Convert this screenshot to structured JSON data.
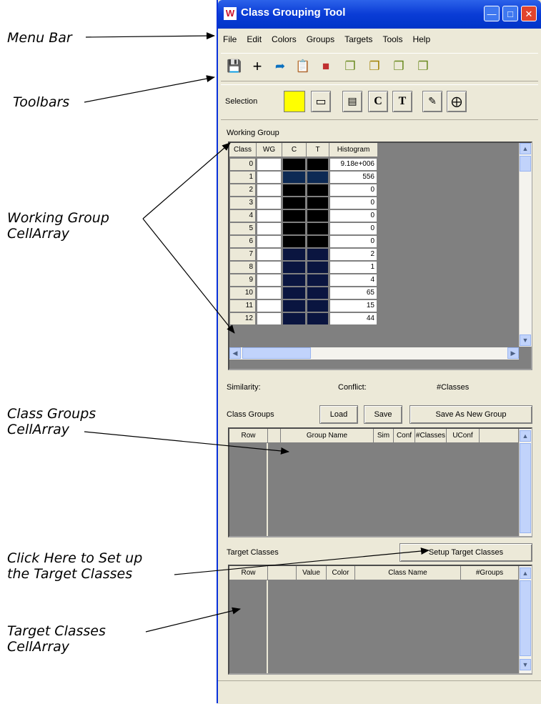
{
  "callouts": {
    "menu_bar": "Menu Bar",
    "toolbars": "Toolbars",
    "working_group": "Working Group\nCellArray",
    "class_groups": "Class Groups\nCellArray",
    "setup_hint": "Click Here to Set up\nthe Target Classes",
    "target_classes": "Target Classes\nCellArray"
  },
  "window": {
    "title": "Class Grouping Tool",
    "menu": [
      "File",
      "Edit",
      "Colors",
      "Groups",
      "Targets",
      "Tools",
      "Help"
    ],
    "toolbar_icons": [
      "save-icon",
      "add-icon",
      "merge-icon",
      "copy-icon",
      "color-icon",
      "group-icon-1",
      "group-icon-2",
      "group-icon-3",
      "group-icon-4"
    ],
    "selection": {
      "label": "Selection",
      "color": "#ffff00",
      "c_label": "C",
      "t_label": "T"
    }
  },
  "working_group": {
    "label": "Working Group",
    "columns": [
      "Class",
      "WG",
      "C",
      "T",
      "Histogram"
    ],
    "rows": [
      {
        "cls": "0",
        "color": "#000000",
        "hist": "9.18e+006"
      },
      {
        "cls": "1",
        "color": "#0d2a54",
        "hist": "556"
      },
      {
        "cls": "2",
        "color": "#000000",
        "hist": "0"
      },
      {
        "cls": "3",
        "color": "#000000",
        "hist": "0"
      },
      {
        "cls": "4",
        "color": "#000000",
        "hist": "0"
      },
      {
        "cls": "5",
        "color": "#000000",
        "hist": "0"
      },
      {
        "cls": "6",
        "color": "#000000",
        "hist": "0"
      },
      {
        "cls": "7",
        "color": "#0a1540",
        "hist": "2"
      },
      {
        "cls": "8",
        "color": "#0a1540",
        "hist": "1"
      },
      {
        "cls": "9",
        "color": "#0a1540",
        "hist": "4"
      },
      {
        "cls": "10",
        "color": "#0a1540",
        "hist": "65"
      },
      {
        "cls": "11",
        "color": "#0a1540",
        "hist": "15"
      },
      {
        "cls": "12",
        "color": "#0a1540",
        "hist": "44"
      }
    ]
  },
  "stats": {
    "similarity": "Similarity:",
    "conflict": "Conflict:",
    "classes": "#Classes"
  },
  "class_groups": {
    "label": "Class Groups",
    "load": "Load",
    "save": "Save",
    "save_new": "Save As New Group",
    "columns": [
      "Row",
      "Group Name",
      "Sim",
      "Conf",
      "#Classes",
      "UConf"
    ]
  },
  "target_classes": {
    "label": "Target Classes",
    "setup": "Setup Target Classes",
    "columns": [
      "Row",
      "Value",
      "Color",
      "Class Name",
      "#Groups"
    ]
  }
}
